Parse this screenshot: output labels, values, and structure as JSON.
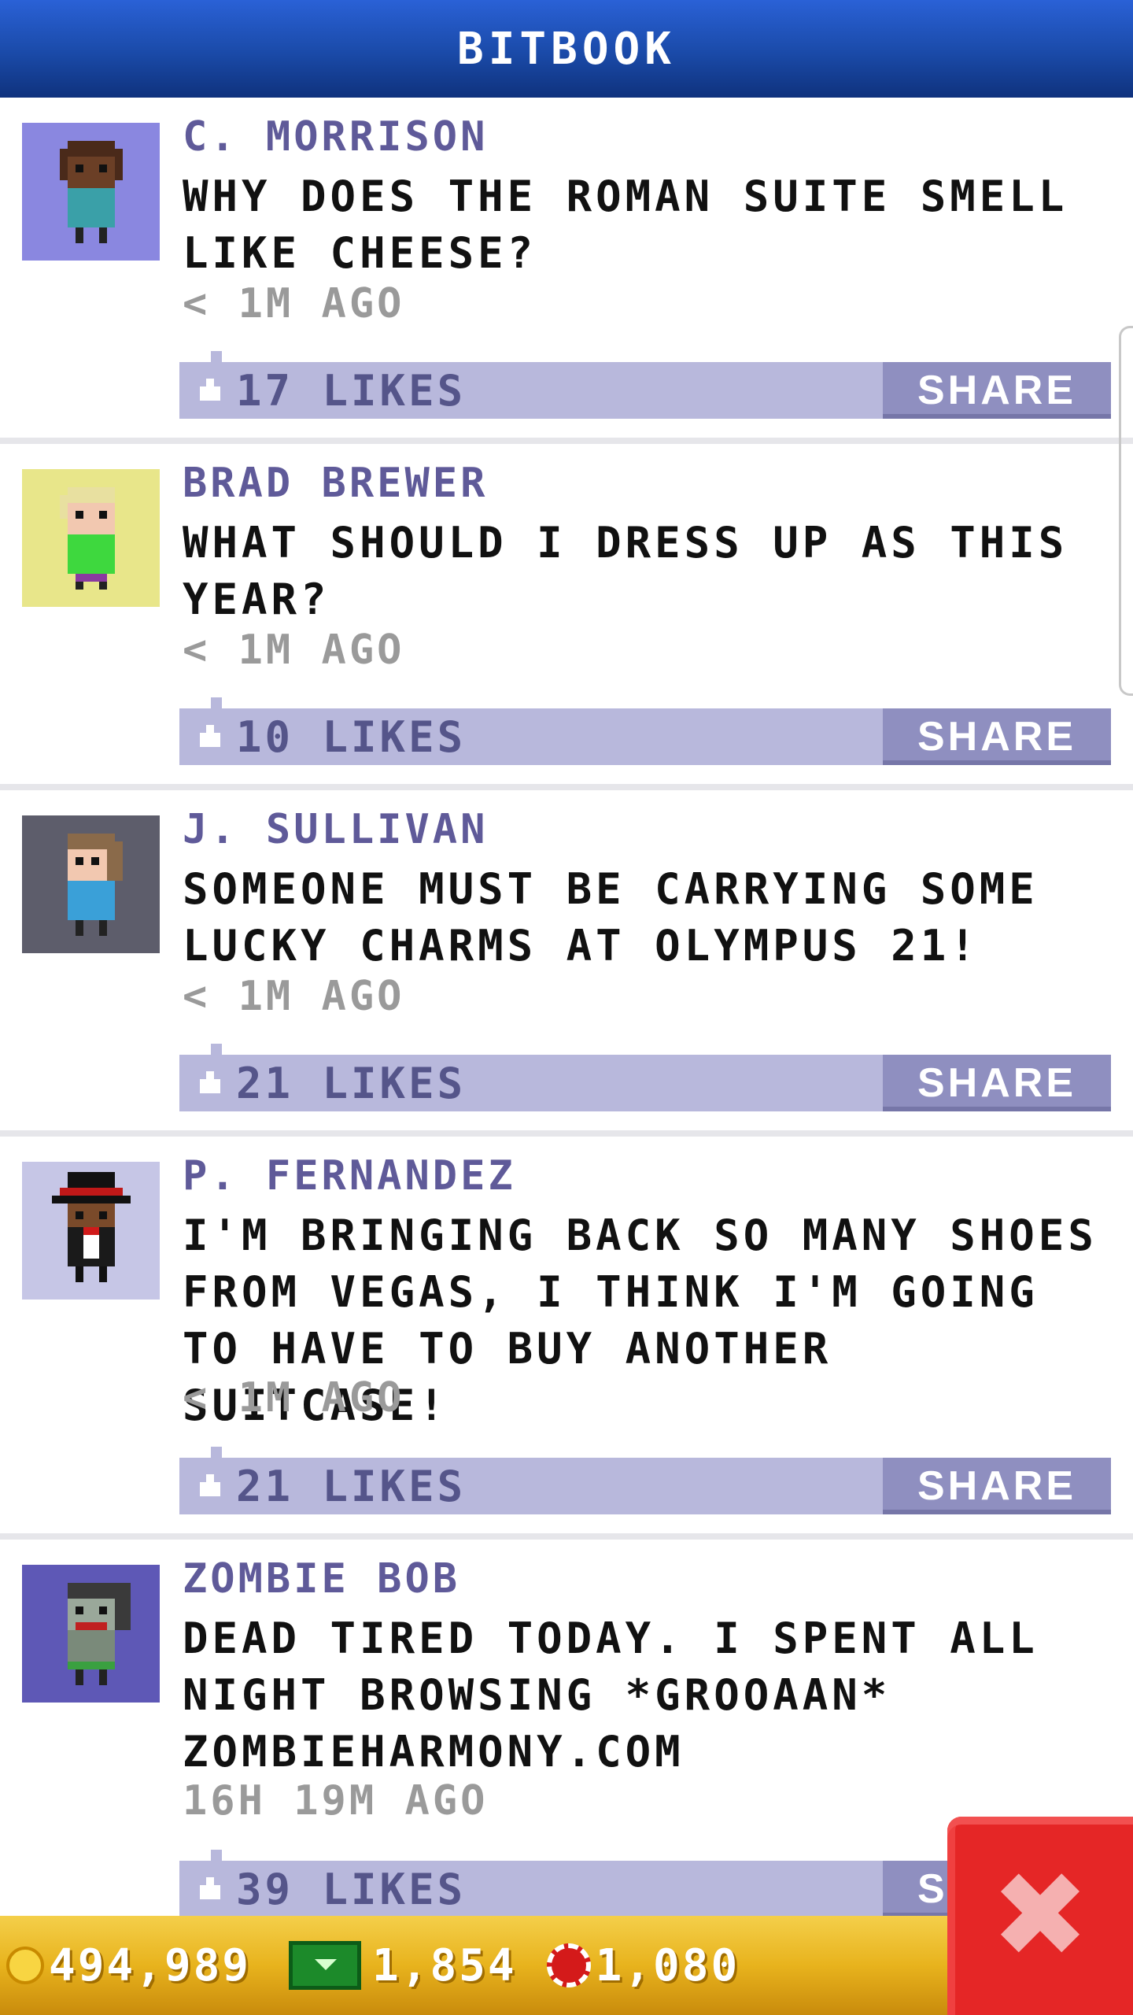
{
  "header": {
    "title": "BITBOOK"
  },
  "posts": [
    {
      "author": "C. MORRISON",
      "message": "WHY DOES THE ROMAN SUITE SMELL LIKE CHEESE?",
      "time": "< 1M AGO",
      "likes": "17 LIKES",
      "share": "SHARE",
      "avatar_bg": "#8a87e0"
    },
    {
      "author": "BRAD BREWER",
      "message": "WHAT SHOULD I DRESS UP AS THIS YEAR?",
      "time": "< 1M AGO",
      "likes": "10 LIKES",
      "share": "SHARE",
      "avatar_bg": "#e8e68a"
    },
    {
      "author": "J. SULLIVAN",
      "message": "SOMEONE MUST BE CARRYING SOME LUCKY CHARMS AT OLYMPUS 21!",
      "time": "< 1M AGO",
      "likes": "21 LIKES",
      "share": "SHARE",
      "avatar_bg": "#5d5d6b"
    },
    {
      "author": "P. FERNANDEZ",
      "message": "I'M BRINGING BACK SO MANY SHOES FROM VEGAS, I THINK I'M GOING TO HAVE TO BUY ANOTHER SUITCASE!",
      "time": "< 1M AGO",
      "likes": "21 LIKES",
      "share": "SHARE",
      "avatar_bg": "#c6c6e6"
    },
    {
      "author": "ZOMBIE BOB",
      "message": "DEAD TIRED TODAY. I SPENT ALL NIGHT BROWSING *GROOAAN* ZOMBIEHARMONY.COM",
      "time": "16H 19M AGO",
      "likes": "39 LIKES",
      "share": "SHARE",
      "avatar_bg": "#5e58b6"
    }
  ],
  "footer": {
    "coins": "494,989",
    "bux": "1,854",
    "chips": "1,080"
  },
  "close": {
    "label": "✖"
  }
}
